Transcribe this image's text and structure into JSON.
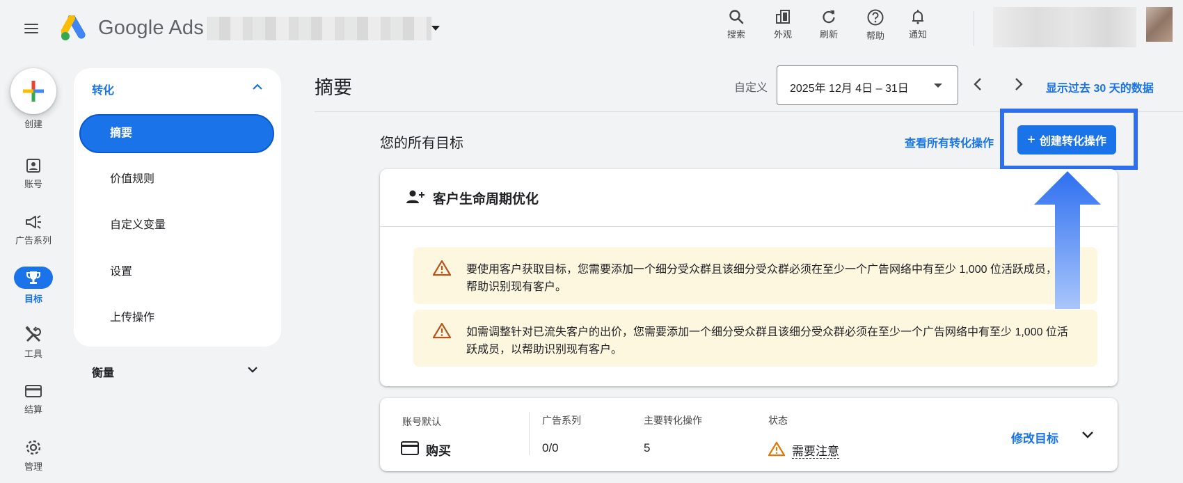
{
  "topbar": {
    "product_name": "Google Ads",
    "tools": [
      {
        "label": "搜索",
        "icon": "search-icon"
      },
      {
        "label": "外观",
        "icon": "appearance-icon"
      },
      {
        "label": "刷新",
        "icon": "refresh-icon"
      },
      {
        "label": "帮助",
        "icon": "help-icon"
      },
      {
        "label": "通知",
        "icon": "bell-icon"
      }
    ]
  },
  "rail": {
    "create_label": "创建",
    "items": [
      {
        "label": "账号",
        "icon": "account-icon"
      },
      {
        "label": "广告系列",
        "icon": "campaign-icon"
      },
      {
        "label": "目标",
        "icon": "trophy-icon"
      },
      {
        "label": "工具",
        "icon": "tools-icon"
      },
      {
        "label": "结算",
        "icon": "billing-icon"
      },
      {
        "label": "管理",
        "icon": "gear-icon"
      }
    ]
  },
  "subnav": {
    "section_title": "转化",
    "items": [
      "摘要",
      "价值规则",
      "自定义变量",
      "设置",
      "上传操作"
    ],
    "measure_label": "衡量"
  },
  "header": {
    "title": "摘要",
    "custom_label": "自定义",
    "date_range": "2025年 12月 4日 – 31日",
    "last_30_link": "显示过去 30 天的数据"
  },
  "goals": {
    "title": "您的所有目标",
    "view_all_link": "查看所有转化操作",
    "create_button": "创建转化操作",
    "lifecycle_card": {
      "title": "客户生命周期优化",
      "warnings": [
        "要使用客户获取目标，您需要添加一个细分受众群且该细分受众群必须在至少一个广告网络中有至少 1,000 位活跃成员，以帮助识别现有客户。",
        "如需调整针对已流失客户的出价，您需要添加一个细分受众群且该细分受众群必须在至少一个广告网络中有至少 1,000 位活跃成员，以帮助识别现有客户。"
      ]
    },
    "purchase_card": {
      "account_default": "账号默认",
      "goal_name": "购买",
      "campaigns_label": "广告系列",
      "campaigns_value": "0/0",
      "primary_actions_label": "主要转化操作",
      "primary_actions_value": "5",
      "status_label": "状态",
      "status_value": "需要注意",
      "edit_link": "修改目标"
    }
  },
  "colors": {
    "accent": "#1a73e8",
    "warning_bg": "#fef7e0",
    "warning_icon": "#b3561c",
    "annotation": "#2e6ff0"
  }
}
